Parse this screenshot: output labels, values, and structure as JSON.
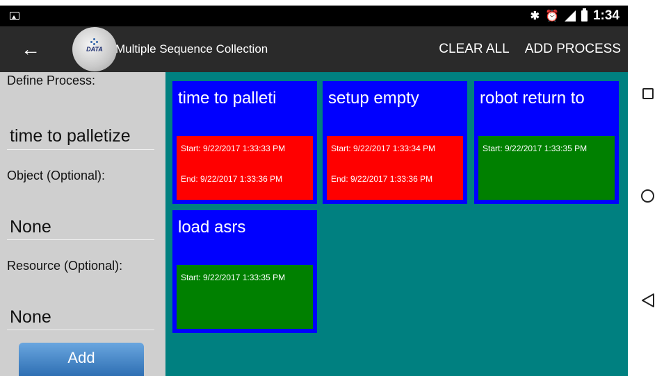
{
  "status_bar": {
    "time": "1:34"
  },
  "app_bar": {
    "title": "Multiple Sequence Collection",
    "logo_text": "DATA",
    "actions": {
      "clear_all": "CLEAR ALL",
      "add_process": "ADD PROCESS"
    }
  },
  "form": {
    "define_process_label": "Define Process:",
    "define_process_value": "time to palletize",
    "object_label": "Object (Optional):",
    "object_value": "None",
    "resource_label": "Resource (Optional):",
    "resource_value": "None",
    "add_button": "Add"
  },
  "cards": [
    {
      "title": "time to palleti",
      "start": "Start: 9/22/2017 1:33:33 PM",
      "end": "End:  9/22/2017 1:33:36 PM",
      "status_color": "#ff0000"
    },
    {
      "title": "setup empty",
      "start": "Start: 9/22/2017 1:33:34 PM",
      "end": "End:  9/22/2017 1:33:36 PM",
      "status_color": "#ff0000"
    },
    {
      "title": "robot return to",
      "start": "Start: 9/22/2017 1:33:35 PM",
      "end": "",
      "status_color": "#008000"
    },
    {
      "title": "load asrs",
      "start": "Start: 9/22/2017 1:33:35 PM",
      "end": "",
      "status_color": "#008000"
    }
  ],
  "colors": {
    "card_bg": "#0000ff",
    "grid_bg": "#008080",
    "finished": "#ff0000",
    "running": "#008000"
  },
  "icons": [
    "image-icon",
    "bluetooth-icon",
    "alarm-icon",
    "lte-signal-icon",
    "battery-icon",
    "back-arrow-icon",
    "recents-icon",
    "home-icon",
    "nav-back-icon"
  ]
}
